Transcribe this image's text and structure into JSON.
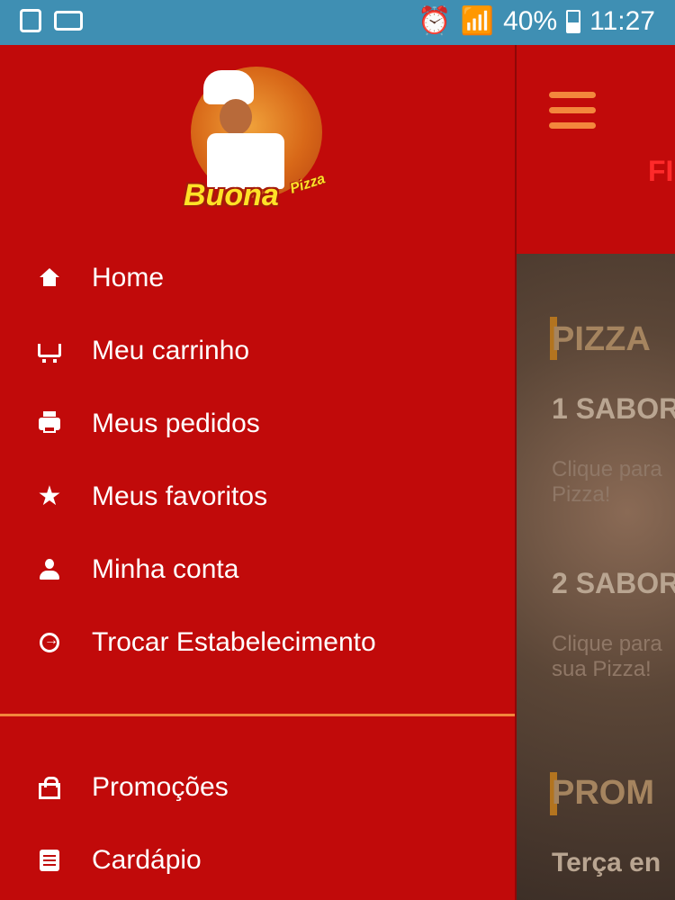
{
  "status_bar": {
    "battery": "40%",
    "time": "11:27",
    "icons": [
      "image-icon",
      "voicemail-icon",
      "alarm-icon",
      "wifi-icon",
      "signal-icon",
      "battery-icon"
    ]
  },
  "drawer": {
    "logo_text": "Buona",
    "logo_subtext": "Pizza",
    "items": [
      {
        "label": "Home",
        "icon": "home-icon"
      },
      {
        "label": "Meu carrinho",
        "icon": "cart-icon"
      },
      {
        "label": "Meus pedidos",
        "icon": "printer-icon"
      },
      {
        "label": "Meus favoritos",
        "icon": "star-icon"
      },
      {
        "label": "Minha conta",
        "icon": "person-icon"
      },
      {
        "label": "Trocar Estabelecimento",
        "icon": "exit-icon"
      }
    ],
    "secondary_items": [
      {
        "label": "Promoções",
        "icon": "bag-icon"
      },
      {
        "label": "Cardápio",
        "icon": "menu-card-icon"
      }
    ]
  },
  "background": {
    "partial_title": "FI",
    "section1": "PIZZA",
    "sub1": "1 SABOR",
    "text1": "Clique para\nPizza!",
    "sub2": "2 SABOR",
    "text2": "Clique para\nsua Pizza!",
    "section2": "PROM",
    "text3": "Terça en"
  },
  "colors": {
    "primary": "#c10a0a",
    "accent": "#f3873c",
    "status_bar": "#3f8fb3"
  }
}
